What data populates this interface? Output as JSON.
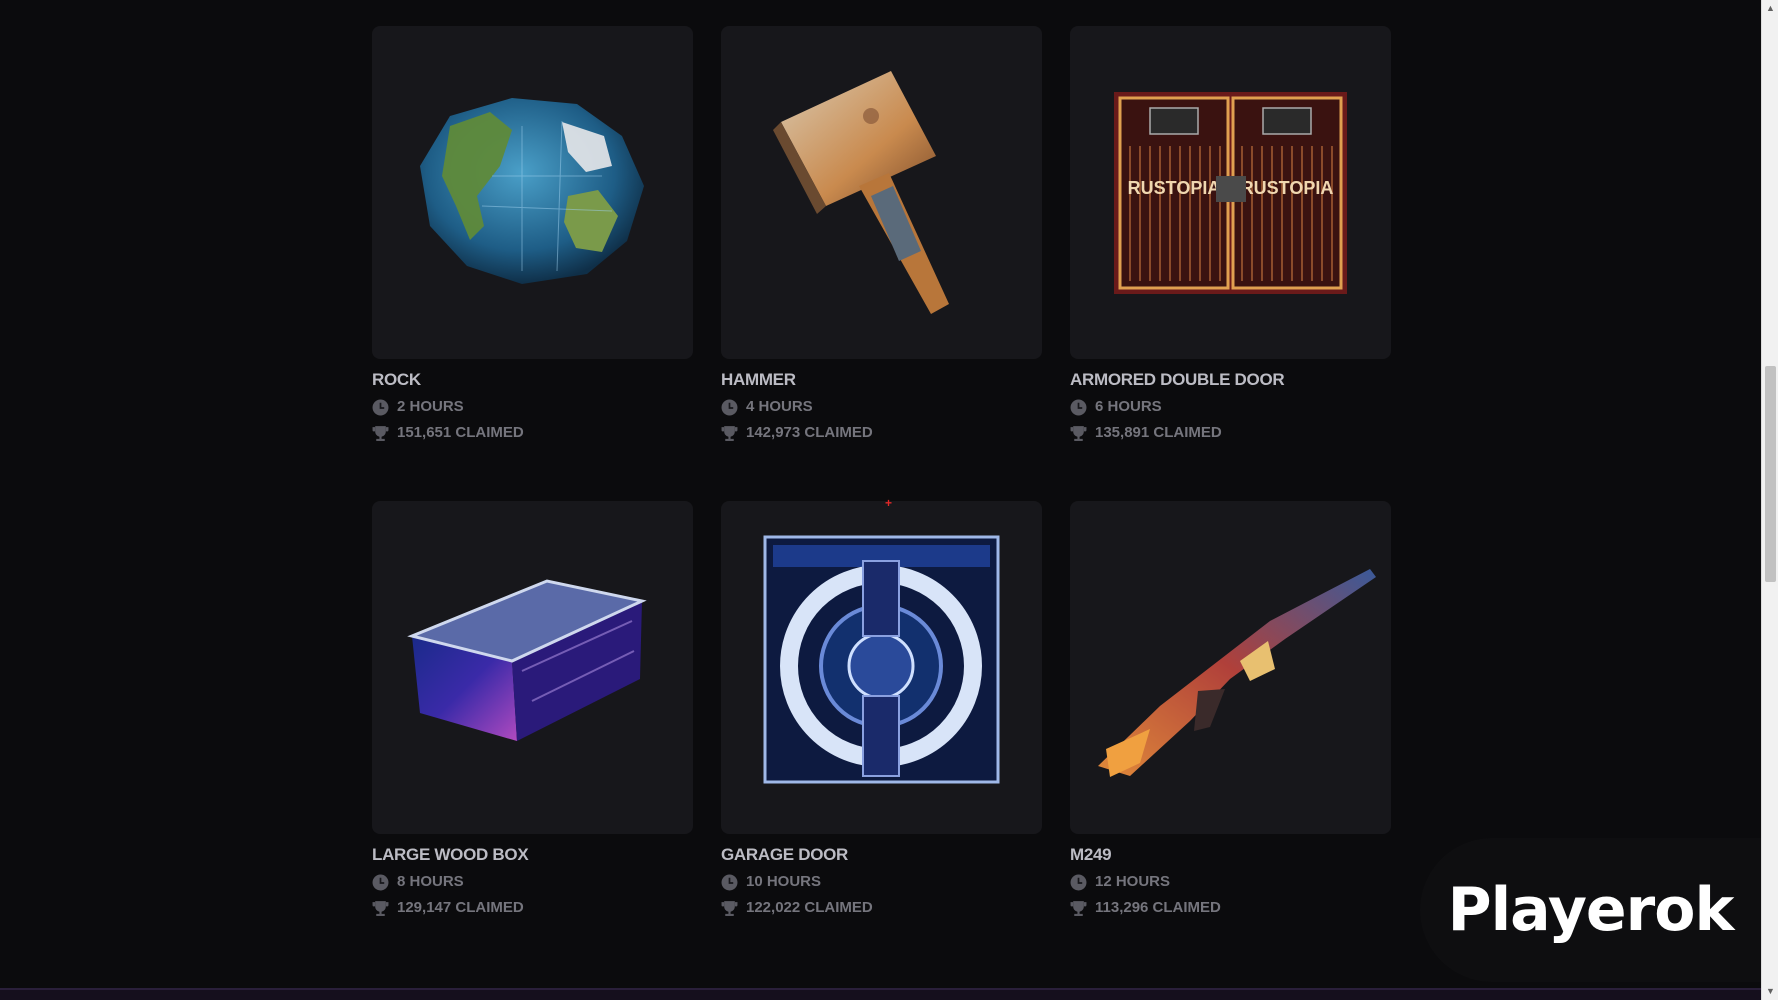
{
  "items": [
    {
      "name": "ROCK",
      "time": "2 HOURS",
      "claimed": "151,651 CLAIMED",
      "image_icon": "earth-rock-icon"
    },
    {
      "name": "HAMMER",
      "time": "4 HOURS",
      "claimed": "142,973 CLAIMED",
      "image_icon": "hammer-icon"
    },
    {
      "name": "ARMORED DOUBLE DOOR",
      "time": "6 HOURS",
      "claimed": "135,891 CLAIMED",
      "image_icon": "rustopia-door-icon",
      "image_text": "RUSTOPIA"
    },
    {
      "name": "LARGE WOOD BOX",
      "time": "8 HOURS",
      "claimed": "129,147 CLAIMED",
      "image_icon": "galaxy-box-icon"
    },
    {
      "name": "GARAGE DOOR",
      "time": "10 HOURS",
      "claimed": "122,022 CLAIMED",
      "image_icon": "sci-fi-garage-door-icon"
    },
    {
      "name": "M249",
      "time": "12 HOURS",
      "claimed": "113,296 CLAIMED",
      "image_icon": "butterfly-rifle-icon"
    }
  ],
  "brand": {
    "text": "Playerok"
  },
  "colors": {
    "background": "#0b0b0d",
    "card": "#17171b",
    "title": "#bcbcc4",
    "meta": "#75757d"
  }
}
